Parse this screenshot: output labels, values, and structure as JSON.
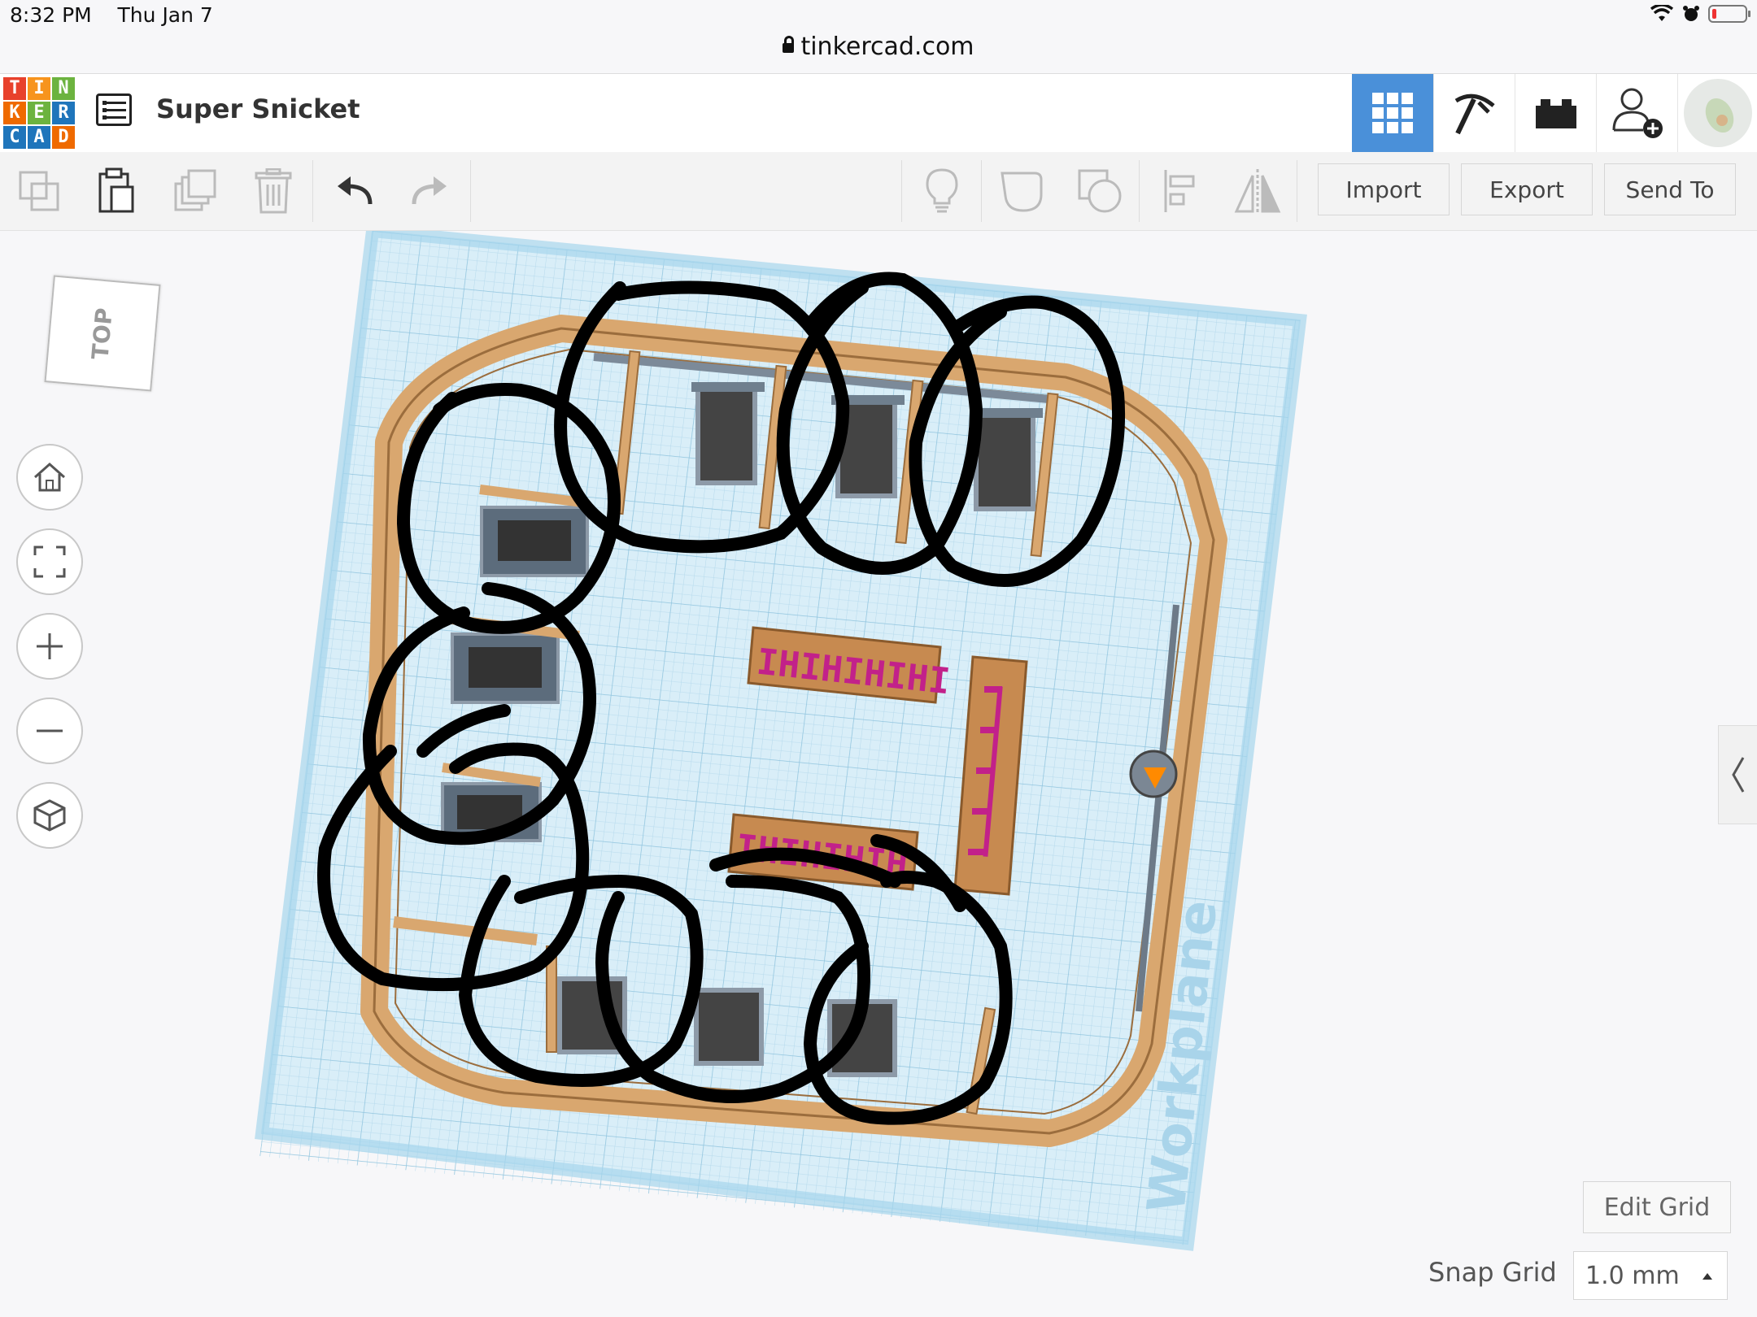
{
  "status_bar": {
    "time": "8:32 PM",
    "date": "Thu Jan 7",
    "url": "tinkercad.com"
  },
  "app": {
    "logo_letters": [
      "T",
      "I",
      "N",
      "K",
      "E",
      "R",
      "C",
      "A",
      "D"
    ],
    "logo_colors": [
      "#e8412c",
      "#f7941d",
      "#6cb33f",
      "#ef6a00",
      "#6cb33f",
      "#1f75bb",
      "#1f75bb",
      "#1f75bb",
      "#ef6a00"
    ],
    "accent": "#4a90d9",
    "document_title": "Super Snicket"
  },
  "header_buttons": [
    {
      "name": "3d-view-grid-icon",
      "active": true
    },
    {
      "name": "codeblocks-pickaxe-icon",
      "active": false
    },
    {
      "name": "bricks-icon",
      "active": false
    },
    {
      "name": "invite-user-icon",
      "active": false
    },
    {
      "name": "avatar",
      "active": false
    }
  ],
  "toolbar": {
    "tools": [
      "copy-icon",
      "paste-icon",
      "duplicate-icon",
      "delete-icon",
      "undo-icon",
      "redo-icon"
    ],
    "right_tools": [
      "lightbulb-icon",
      "shape-note-icon",
      "group-icon",
      "align-icon",
      "mirror-icon"
    ],
    "import_label": "Import",
    "export_label": "Export",
    "send_to_label": "Send To"
  },
  "view": {
    "viewcube_label": "TOP",
    "nav_buttons": [
      "home-icon",
      "fit-view-icon",
      "zoom-in-icon",
      "zoom-out-icon",
      "perspective-icon"
    ],
    "workplane_label": "Workplane"
  },
  "grid": {
    "edit_grid_label": "Edit Grid",
    "snap_grid_label": "Snap Grid",
    "snap_grid_value": "1.0 mm"
  }
}
